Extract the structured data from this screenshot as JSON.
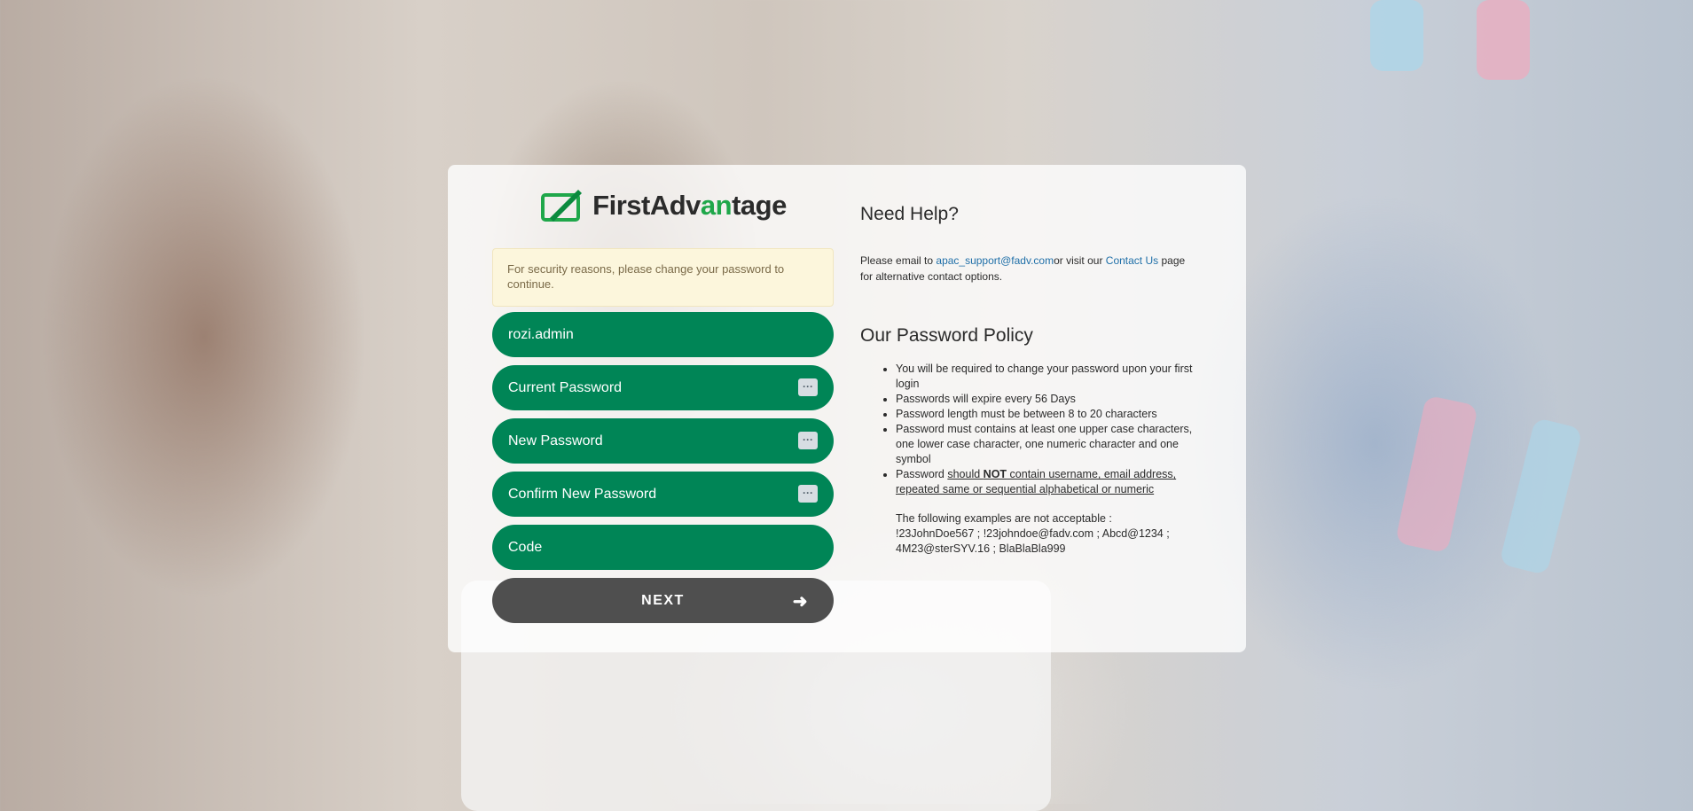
{
  "brand": {
    "name_part1": "First",
    "name_part2": "Adv",
    "name_part3": "an",
    "name_part4": "tage",
    "logo_color": "#1fa74a"
  },
  "alert": {
    "text": "For security reasons, please change your password to continue."
  },
  "form": {
    "username_value": "rozi.admin",
    "current_password_placeholder": "Current Password",
    "new_password_placeholder": "New Password",
    "confirm_password_placeholder": "Confirm New Password",
    "code_placeholder": "Code",
    "reveal_label": "···",
    "next_label": "NEXT",
    "next_arrow": "➜"
  },
  "help": {
    "title": "Need Help?",
    "text_prefix": "Please email to ",
    "email": "apac_support@fadv.com",
    "text_mid": "or visit our ",
    "contact_link": "Contact Us",
    "text_suffix": " page for alternative contact options."
  },
  "policy": {
    "title": "Our Password Policy",
    "rules": [
      "You will be required to change your password upon your first login",
      "Passwords will expire every 56 Days",
      "Password length must be between 8 to 20 characters",
      "Password must contains at least one upper case characters, one lower case character, one numeric character and one symbol"
    ],
    "rule5_prefix": "Password ",
    "rule5_should": "should ",
    "rule5_not": "NOT",
    "rule5_rest": " contain username, email address, repeated same or sequential alphabetical or numeric",
    "examples_intro": "The following examples are not acceptable :",
    "examples_list": "!23JohnDoe567 ; !23johndoe@fadv.com ; Abcd@1234 ; 4M23@sterSYV.16 ; BlaBlaBla999"
  },
  "colors": {
    "field_green": "#008556",
    "next_gray": "#4f4f4f",
    "alert_bg": "#fcf6dc",
    "link_blue": "#1f6fa8"
  }
}
